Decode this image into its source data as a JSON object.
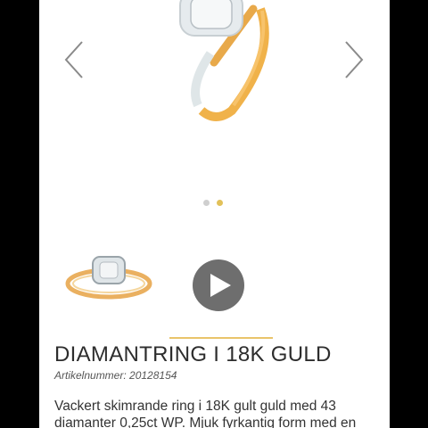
{
  "product": {
    "title": "DIAMANTRING I 18K GULD",
    "article_label": "Artikelnummer:",
    "article_number": "20128154",
    "description": "Vackert skimrande ring i 18K gult guld med 43 diamanter 0,25ct WP. Mjuk fyrkantig form med en"
  },
  "gallery": {
    "slide_count": 2,
    "active_slide": 2
  },
  "thumbnails": [
    {
      "type": "image",
      "icon": "ring-thumbnail"
    },
    {
      "type": "video",
      "icon": "play-icon"
    }
  ],
  "colors": {
    "accent_gold": "#e9c46a",
    "ring_gold": "#f0b24a",
    "dot_inactive": "#cfcfcf",
    "dot_active": "#e2c15a",
    "play_button": "#6e6e6e"
  }
}
